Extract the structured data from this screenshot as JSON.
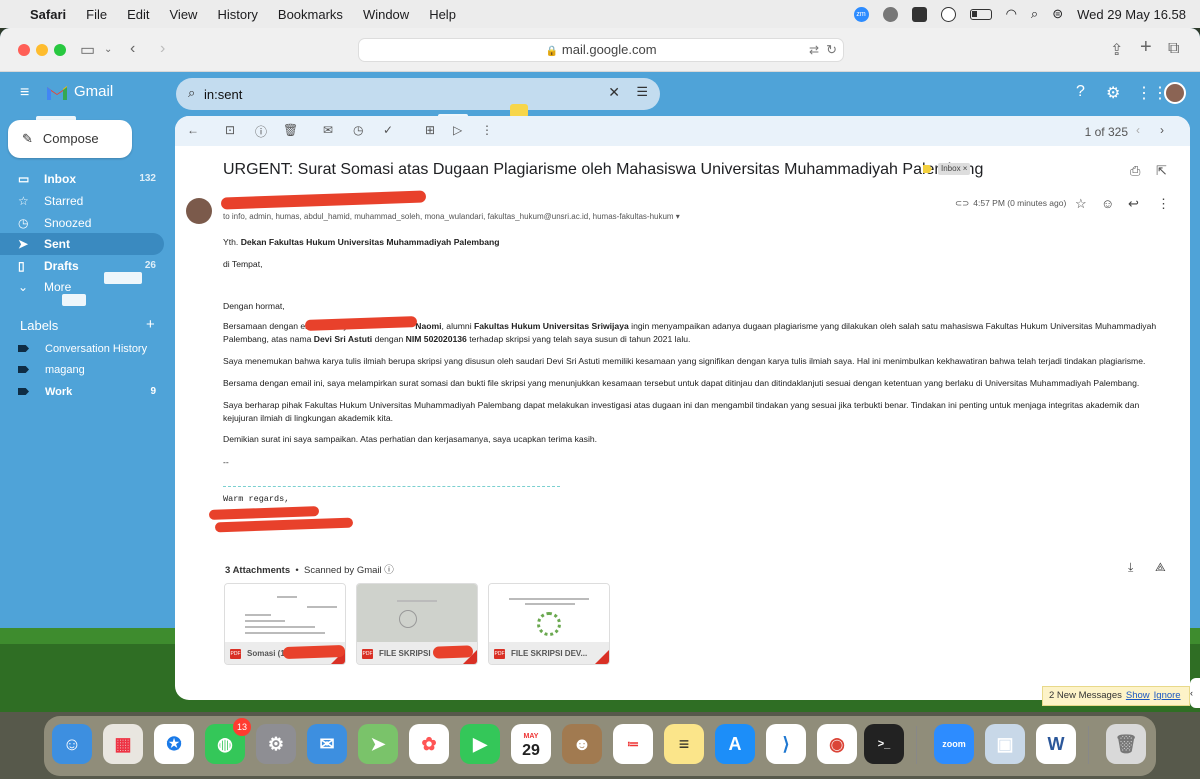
{
  "menubar": {
    "app": "Safari",
    "items": [
      "File",
      "Edit",
      "View",
      "History",
      "Bookmarks",
      "Window",
      "Help"
    ],
    "zoom_badge": "zm",
    "datetime": "Wed 29 May  16.58"
  },
  "browser": {
    "url": "mail.google.com"
  },
  "gmail": {
    "brand": "Gmail",
    "search_value": "in:sent",
    "compose": "Compose",
    "nav": [
      {
        "label": "Inbox",
        "count": "132"
      },
      {
        "label": "Starred",
        "count": ""
      },
      {
        "label": "Snoozed",
        "count": ""
      },
      {
        "label": "Sent",
        "count": ""
      },
      {
        "label": "Drafts",
        "count": "26"
      },
      {
        "label": "More",
        "count": ""
      }
    ],
    "labels_title": "Labels",
    "labels": [
      {
        "label": "Conversation History",
        "count": ""
      },
      {
        "label": "magang",
        "count": ""
      },
      {
        "label": "Work",
        "count": "9"
      }
    ]
  },
  "email": {
    "pager": "1 of 325",
    "subject": "URGENT: Surat Somasi atas Dugaan Plagiarisme oleh Mahasiswa Universitas Muhammadiyah Palembang",
    "inbox_chip": "Inbox ×",
    "to": "to info, admin, humas, abdul_hamid, muhammad_soleh, mona_wulandari, fakultas_hukum@unsri.ac.id, humas-fakultas-hukum",
    "time": "4:57 PM (0 minutes ago)",
    "body": {
      "greet_pre": "Yth. ",
      "greet_bold": "Dekan Fakultas Hukum Universitas Muhammadiyah Palembang",
      "place": "di Tempat,",
      "salam": "Dengan hormat,",
      "p1_a": "Bersamaan dengan email ini saya ",
      "p1_name": "Naomi",
      "p1_b": ", alumni ",
      "p1_fak": "Fakultas Hukum Universitas Sriwijaya",
      "p1_c": " ingin menyampaikan adanya dugaan plagiarisme yang dilakukan oleh salah satu mahasiswa Fakultas Hukum Universitas Muhammadiyah Palembang, atas nama ",
      "p1_student": "Devi Sri Astuti",
      "p1_d": " dengan ",
      "p1_nim": "NIM 502020136",
      "p1_e": " terhadap skripsi yang telah saya susun di tahun 2021 lalu.",
      "p2": "Saya menemukan bahwa karya tulis ilmiah berupa skripsi yang disusun oleh saudari Devi Sri Astuti memiliki kesamaan yang signifikan dengan karya tulis ilmiah saya. Hal ini menimbulkan kekhawatiran bahwa telah terjadi tindakan plagiarisme.",
      "p3": "Bersama dengan email ini, saya melampirkan surat somasi dan bukti file skripsi yang menunjukkan kesamaan tersebut untuk dapat ditinjau dan ditindaklanjuti sesuai dengan ketentuan yang berlaku di Universitas Muhammadiyah Palembang.",
      "p4": "Saya berharap pihak Fakultas Hukum Universitas Muhammadiyah Palembang dapat melakukan investigasi atas dugaan ini dan mengambil tindakan yang sesuai jika terbukti benar. Tindakan ini penting untuk menjaga integritas akademik dan kejujuran ilmiah di lingkungan akademik kita.",
      "p5": "Demikian surat ini saya sampaikan. Atas perhatian dan kerjasamanya, saya ucapkan terima kasih.",
      "sig_dash": "--",
      "warm": "Warm regards,"
    },
    "attachments_count": "3 Attachments",
    "scanned": "Scanned by Gmail",
    "attachments": [
      "Somasi (1...",
      "FILE SKRIPSI",
      "FILE SKRIPSI DEV..."
    ]
  },
  "notification": {
    "text": "2 New Messages",
    "show": "Show",
    "ignore": "Ignore"
  },
  "dock": {
    "messages_badge": "13",
    "calendar_month": "MAY",
    "calendar_day": "29",
    "zoom": "zoom"
  }
}
